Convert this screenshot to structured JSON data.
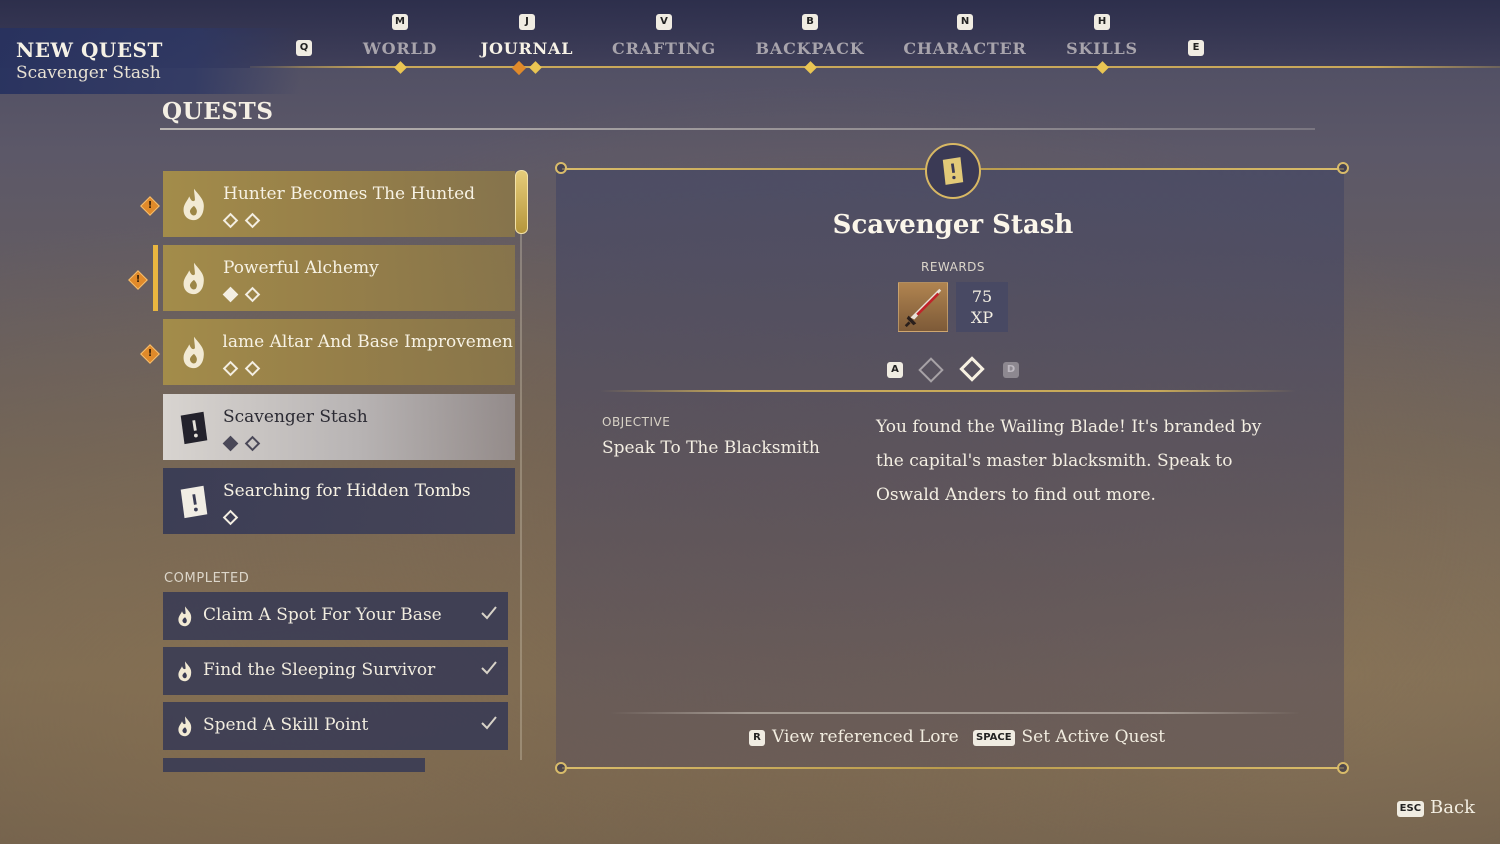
{
  "header": {
    "title": "NEW QUEST",
    "subtitle": "Scavenger Stash"
  },
  "nav": {
    "prev_key": "Q",
    "next_key": "E",
    "tabs": [
      {
        "key": "M",
        "label": "WORLD"
      },
      {
        "key": "J",
        "label": "JOURNAL"
      },
      {
        "key": "V",
        "label": "CRAFTING"
      },
      {
        "key": "B",
        "label": "BACKPACK"
      },
      {
        "key": "N",
        "label": "CHARACTER"
      },
      {
        "key": "H",
        "label": "SKILLS"
      }
    ],
    "active_tab": "JOURNAL"
  },
  "quests": {
    "heading": "QUESTS",
    "active": [
      {
        "title": "Hunter Becomes The Hunted",
        "steps": [
          false,
          false
        ],
        "new": true
      },
      {
        "title": "Powerful Alchemy",
        "steps": [
          true,
          false
        ],
        "new": true,
        "tracked": true
      },
      {
        "title": "Flame Altar And Base Improvemen",
        "steps": [
          false,
          false
        ],
        "new": true
      },
      {
        "title": "Scavenger Stash",
        "steps": [
          true,
          false
        ],
        "selected": true
      },
      {
        "title": "Searching for Hidden Tombs",
        "steps": [
          false
        ]
      }
    ],
    "completed_label": "COMPLETED",
    "completed": [
      {
        "title": "Claim A Spot For Your Base"
      },
      {
        "title": "Find the Sleeping Survivor"
      },
      {
        "title": "Spend A Skill Point"
      }
    ]
  },
  "detail": {
    "title": "Scavenger Stash",
    "rewards_label": "REWARDS",
    "reward_xp_value": "75",
    "reward_xp_unit": "XP",
    "page_prev_key": "A",
    "page_next_key": "D",
    "page_current": 2,
    "page_total": 2,
    "objective_label": "OBJECTIVE",
    "objective_text": "Speak To The Blacksmith",
    "description": "You found the Wailing Blade! It's branded by the capital's master blacksmith. Speak to Oswald Anders to find out more."
  },
  "actions": {
    "lore_key": "R",
    "lore_label": "View referenced Lore",
    "active_key": "SPACE",
    "active_label": "Set Active Quest"
  },
  "footer": {
    "back_key": "ESC",
    "back_label": "Back"
  },
  "colors": {
    "accent_gold": "#d9bc6a",
    "alert_orange": "#e08a2a",
    "panel_navy": "#3a3c54"
  }
}
